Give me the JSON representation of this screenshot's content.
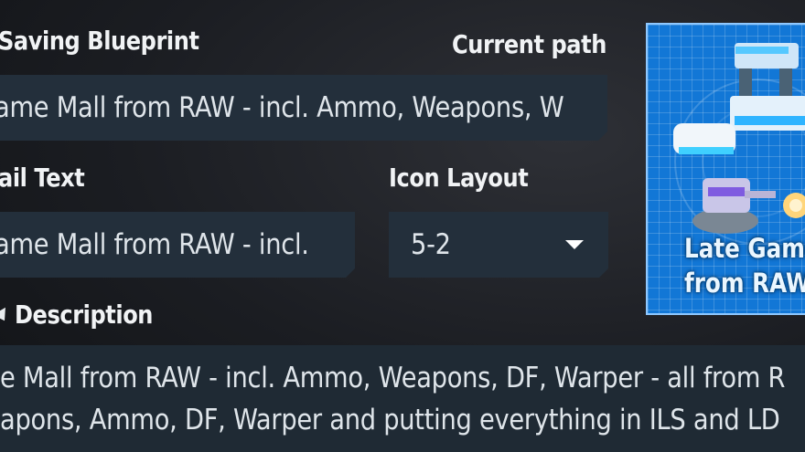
{
  "labels": {
    "saving_blueprint": "Saving Blueprint",
    "current_path": "Current path",
    "thumbnail_text": "ail Text",
    "icon_layout": "Icon Layout",
    "description": "Description"
  },
  "fields": {
    "blueprint_name": "ame Mall  from RAW - incl. Ammo, Weapons, W",
    "thumbnail_text": "ame Mall  from RAW - incl.",
    "icon_layout_value": "5-2"
  },
  "description_lines": [
    "e Mall  from RAW - incl. Ammo, Weapons, DF, Warper - all from R",
    "apons, Ammo, DF, Warper and putting everything in ILS and LD"
  ],
  "thumbnail": {
    "line1": "Late Game",
    "line2": "from RAW"
  },
  "icons": {
    "layout_dropdown": "caret-down-icon",
    "description_toggle": "caret-icon"
  },
  "colors": {
    "field_bg": "#232f3b",
    "thumbnail_bg": "#1277d6",
    "thumbnail_border": "#8ec8ff"
  }
}
